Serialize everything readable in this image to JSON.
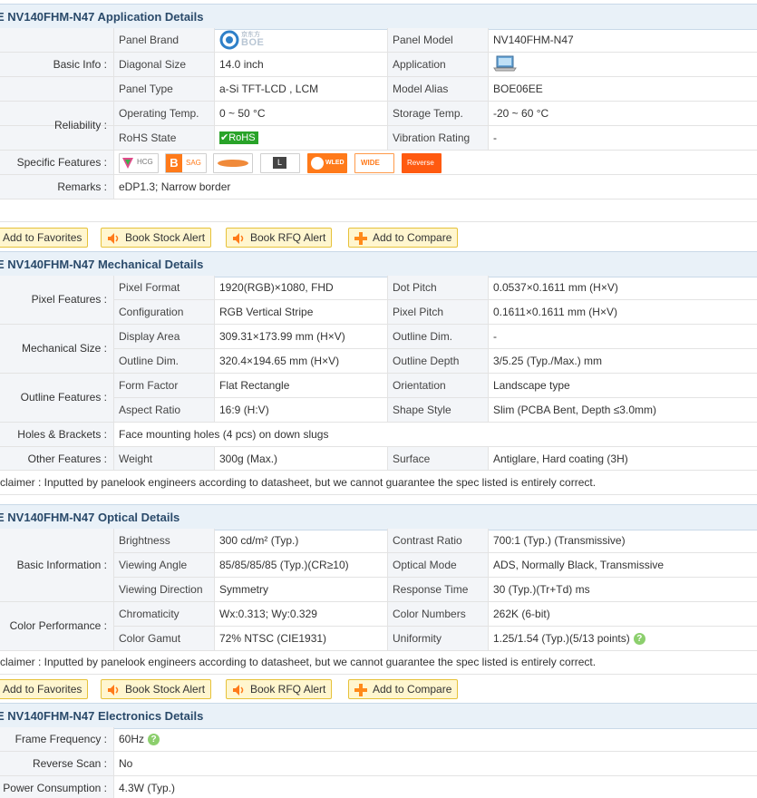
{
  "application": {
    "title": "E NV140FHM-N47 Application Details",
    "groups": {
      "basic_info": "Basic Info :",
      "reliability": "Reliability :",
      "specific_features": "Specific Features :",
      "remarks": "Remarks :"
    },
    "rows": [
      {
        "l1": "Panel Brand",
        "v1": "BOE",
        "l2": "Panel Model",
        "v2": "NV140FHM-N47"
      },
      {
        "l1": "Diagonal Size",
        "v1": "14.0 inch",
        "l2": "Application",
        "v2": "laptop-icon"
      },
      {
        "l1": "Panel Type",
        "v1": "a-Si TFT-LCD , LCM",
        "l2": "Model Alias",
        "v2": "BOE06EE"
      },
      {
        "l1": "Operating Temp.",
        "v1": "0 ~ 50 °C",
        "l2": "Storage Temp.",
        "v2": "-20 ~ 60 °C"
      },
      {
        "l1": "RoHS State",
        "v1": "RoHS",
        "l2": "Vibration Rating",
        "v2": "-"
      }
    ],
    "brand_logo_text": "京东方",
    "features": [
      "HCG",
      "SAG",
      "",
      "L",
      "WLED",
      "WIDE",
      "Reverse"
    ],
    "remarks": "eDP1.3; Narrow border"
  },
  "buttons": {
    "favorites": "Add to Favorites",
    "stock": "Book Stock Alert",
    "rfq": "Book RFQ Alert",
    "compare": "Add to Compare"
  },
  "mechanical": {
    "title": "E NV140FHM-N47 Mechanical Details",
    "groups": {
      "pixel": "Pixel Features :",
      "size": "Mechanical Size :",
      "outline": "Outline Features :",
      "holes": "Holes & Brackets :",
      "other": "Other Features :"
    },
    "rows": [
      {
        "l1": "Pixel Format",
        "v1": "1920(RGB)×1080, FHD",
        "l2": "Dot Pitch",
        "v2": "0.0537×0.1611 mm (H×V)"
      },
      {
        "l1": "Configuration",
        "v1": "RGB Vertical Stripe",
        "l2": "Pixel Pitch",
        "v2": "0.1611×0.1611 mm (H×V)"
      },
      {
        "l1": "Display Area",
        "v1": "309.31×173.99 mm (H×V)",
        "l2": "Outline Dim.",
        "v2": "-"
      },
      {
        "l1": "Outline Dim.",
        "v1": "320.4×194.65 mm (H×V)",
        "l2": "Outline Depth",
        "v2": "3/5.25 (Typ./Max.) mm"
      },
      {
        "l1": "Form Factor",
        "v1": "Flat Rectangle",
        "l2": "Orientation",
        "v2": "Landscape type"
      },
      {
        "l1": "Aspect Ratio",
        "v1": "16:9 (H:V)",
        "l2": "Shape Style",
        "v2": "Slim (PCBA Bent, Depth ≤3.0mm)"
      }
    ],
    "holes": "Face mounting holes (4 pcs) on down slugs",
    "other": {
      "l1": "Weight",
      "v1": "300g (Max.)",
      "l2": "Surface",
      "v2": "Antiglare, Hard coating (3H)"
    },
    "disclaimer": "claimer : Inputted by panelook engineers according to datasheet, but we cannot guarantee the spec listed is entirely correct."
  },
  "optical": {
    "title": "E NV140FHM-N47 Optical Details",
    "groups": {
      "basic": "Basic Information :",
      "color": "Color Performance :"
    },
    "rows": [
      {
        "l1": "Brightness",
        "v1": "300 cd/m² (Typ.)",
        "l2": "Contrast Ratio",
        "v2": "700:1 (Typ.) (Transmissive)"
      },
      {
        "l1": "Viewing Angle",
        "v1": "85/85/85/85 (Typ.)(CR≥10)",
        "l2": "Optical Mode",
        "v2": "ADS, Normally Black, Transmissive"
      },
      {
        "l1": "Viewing Direction",
        "v1": "Symmetry",
        "l2": "Response Time",
        "v2": "30 (Typ.)(Tr+Td) ms"
      },
      {
        "l1": "Chromaticity",
        "v1": "Wx:0.313; Wy:0.329",
        "l2": "Color Numbers",
        "v2": "262K (6-bit)"
      },
      {
        "l1": "Color Gamut",
        "v1": "72% NTSC (CIE1931)",
        "l2": "Uniformity",
        "v2": "1.25/1.54 (Typ.)(5/13 points)"
      }
    ],
    "disclaimer": "claimer : Inputted by panelook engineers according to datasheet, but we cannot guarantee the spec listed is entirely correct."
  },
  "electronics": {
    "title": "E NV140FHM-N47 Electronics Details",
    "rows": [
      {
        "label": "Frame Frequency :",
        "value": "60Hz"
      },
      {
        "label": "Reverse Scan :",
        "value": "No"
      },
      {
        "label": "Power Consumption :",
        "value": "4.3W (Typ.)"
      }
    ]
  },
  "colors": {
    "header_bg": "#e9f1f8",
    "label_bg": "#f3f5f8",
    "title": "#2a4a6a",
    "button_bg": "#fff6cf",
    "button_border": "#e6c23a",
    "rohs_green": "#29a329"
  }
}
